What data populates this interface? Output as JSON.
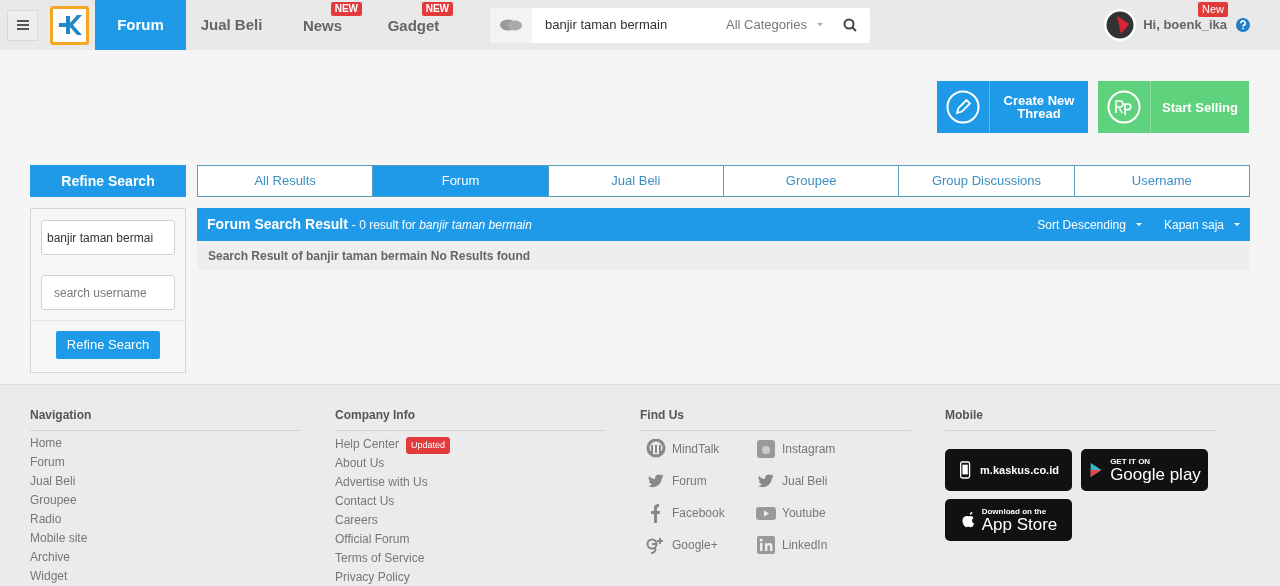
{
  "header": {
    "nav": [
      {
        "label": "Forum",
        "selected": true
      },
      {
        "label": "Jual Beli",
        "selected": false
      },
      {
        "label": "News",
        "selected": false,
        "badge": "NEW"
      },
      {
        "label": "Gadget",
        "selected": false,
        "badge": "NEW"
      }
    ],
    "search": {
      "value": "banjir taman bermain",
      "category": "All Categories"
    },
    "user": {
      "greeting": "Hi, boenk_ika",
      "badge": "New"
    }
  },
  "actions": [
    {
      "kind": "thread",
      "label": "Create New Thread"
    },
    {
      "kind": "sell",
      "label": "Start Selling"
    }
  ],
  "refine": {
    "title": "Refine Search",
    "keyword": "banjir taman bermai",
    "username_placeholder": "search username",
    "button": "Refine Search"
  },
  "tabs": [
    {
      "label": "All Results",
      "selected": false
    },
    {
      "label": "Forum",
      "selected": true
    },
    {
      "label": "Jual Beli",
      "selected": false
    },
    {
      "label": "Groupee",
      "selected": false
    },
    {
      "label": "Group Discussions",
      "selected": false
    },
    {
      "label": "Username",
      "selected": false
    }
  ],
  "result": {
    "title": "Forum Search Result",
    "summary": "- 0 result for *banjir taman bermain*",
    "sort": "Sort Descending",
    "time": "Kapan saja",
    "message": "Search Result of banjir taman bermain No Results found"
  },
  "footer": {
    "navigation": {
      "title": "Navigation",
      "links": [
        "Home",
        "Forum",
        "Jual Beli",
        "Groupee",
        "Radio",
        "Mobile site",
        "Archive",
        "Widget"
      ]
    },
    "company": {
      "title": "Company Info",
      "links": [
        {
          "label": "Help Center",
          "badge": "Updated"
        },
        {
          "label": "About Us"
        },
        {
          "label": "Advertise with Us"
        },
        {
          "label": "Contact Us"
        },
        {
          "label": "Careers"
        },
        {
          "label": "Official Forum"
        },
        {
          "label": "Terms of Service"
        },
        {
          "label": "Privacy Policy"
        }
      ]
    },
    "find_us": {
      "title": "Find Us",
      "links": [
        {
          "kind": "mindtalk",
          "label": "MindTalk"
        },
        {
          "kind": "instagram",
          "label": "Instagram"
        },
        {
          "kind": "twitter",
          "label": "Forum"
        },
        {
          "kind": "twitter",
          "label": "Jual Beli"
        },
        {
          "kind": "facebook",
          "label": "Facebook"
        },
        {
          "kind": "youtube",
          "label": "Youtube"
        },
        {
          "kind": "googleplus",
          "label": "Google+"
        },
        {
          "kind": "linkedin",
          "label": "LinkedIn"
        }
      ]
    },
    "mobile": {
      "title": "Mobile",
      "badges": [
        {
          "kind": "site",
          "lines": [
            "m.kaskus.co.id"
          ]
        },
        {
          "kind": "play",
          "lines": [
            "GET IT ON",
            "Google play"
          ]
        },
        {
          "kind": "apple",
          "lines": [
            "Download on the",
            "App Store"
          ]
        }
      ]
    }
  }
}
